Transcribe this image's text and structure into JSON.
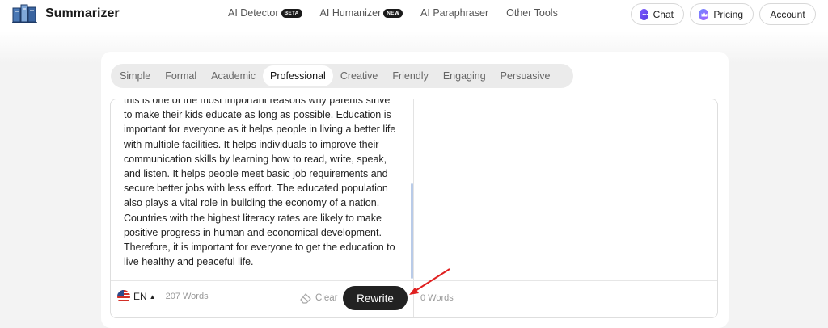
{
  "header": {
    "app_name": "Summarizer",
    "nav": [
      {
        "label": "AI Detector",
        "badge": "BETA"
      },
      {
        "label": "AI Humanizer",
        "badge": "NEW"
      },
      {
        "label": "AI Paraphraser",
        "badge": ""
      },
      {
        "label": "Other Tools",
        "badge": ""
      }
    ],
    "chat_label": "Chat",
    "pricing_label": "Pricing",
    "account_label": "Account"
  },
  "modes": [
    "Simple",
    "Formal",
    "Academic",
    "Professional",
    "Creative",
    "Friendly",
    "Engaging",
    "Persuasive"
  ],
  "active_mode": "Professional",
  "input": {
    "text": "this is one of the most important reasons why parents strive to make their kids educate as long as possible. Education is important for everyone as it helps people in living a better life with multiple facilities. It helps individuals to improve their communication skills by learning how to read, write, speak, and listen. It helps people meet basic job requirements and secure better jobs with less effort. The educated population also plays a vital role in building the economy of a nation. Countries with the highest literacy rates are likely to make positive progress in human and economical development. Therefore, it is important for everyone to get the education to live healthy and peaceful life.",
    "language": "EN",
    "word_count": "207 Words",
    "clear_label": "Clear",
    "rewrite_label": "Rewrite"
  },
  "output": {
    "word_count": "0 Words"
  },
  "colors": {
    "primary_button": "#222222",
    "annotation_arrow": "#e02020"
  },
  "icons": {
    "logo": "book-stack-icon",
    "chat": "chat-bubble-icon",
    "pricing": "crown-icon",
    "flag": "us-flag-icon",
    "clear": "eraser-icon"
  }
}
